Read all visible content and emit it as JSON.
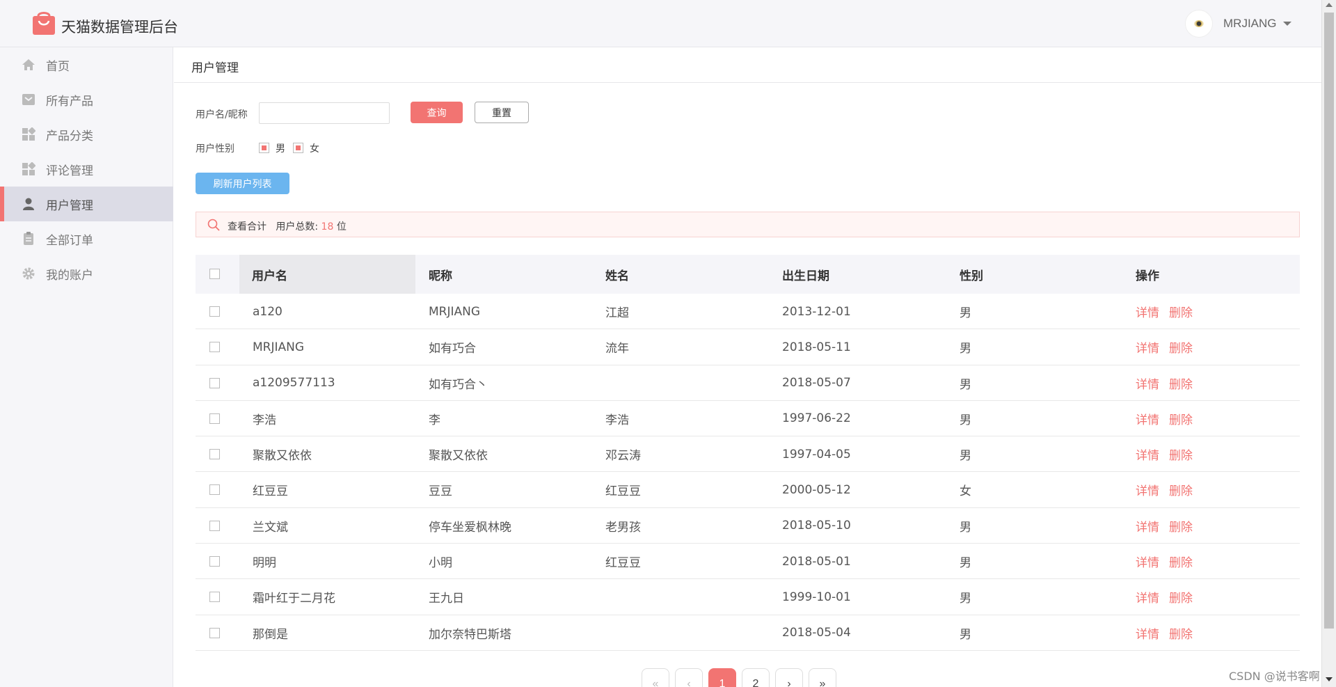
{
  "app": {
    "title": "天猫数据管理后台",
    "user": "MRJIANG"
  },
  "sidebar": {
    "items": [
      {
        "label": "首页",
        "icon": "home-icon"
      },
      {
        "label": "所有产品",
        "icon": "products-icon"
      },
      {
        "label": "产品分类",
        "icon": "category-icon"
      },
      {
        "label": "评论管理",
        "icon": "review-icon"
      },
      {
        "label": "用户管理",
        "icon": "user-icon",
        "active": true
      },
      {
        "label": "全部订单",
        "icon": "orders-icon"
      },
      {
        "label": "我的账户",
        "icon": "gear-icon"
      }
    ]
  },
  "page": {
    "title": "用户管理"
  },
  "filters": {
    "name_label": "用户名/昵称",
    "name_value": "",
    "query_label": "查询",
    "reset_label": "重置",
    "gender_label": "用户性别",
    "gender_options": [
      {
        "label": "男",
        "checked": true
      },
      {
        "label": "女",
        "checked": true
      }
    ],
    "refresh_label": "刷新用户列表"
  },
  "summary": {
    "view_label": "查看合计",
    "total_label": "用户总数:",
    "total": "18",
    "unit": "位"
  },
  "table": {
    "columns": [
      "用户名",
      "昵称",
      "姓名",
      "出生日期",
      "性别",
      "操作"
    ],
    "rows": [
      {
        "username": "a120",
        "nickname": "MRJIANG",
        "name": "江超",
        "birthday": "2013-12-01",
        "gender": "男"
      },
      {
        "username": "MRJIANG",
        "nickname": "如有巧合",
        "name": "流年",
        "birthday": "2018-05-11",
        "gender": "男"
      },
      {
        "username": "a1209577113",
        "nickname": "如有巧合丶",
        "name": "",
        "birthday": "2018-05-07",
        "gender": "男"
      },
      {
        "username": "李浩",
        "nickname": "李",
        "name": "李浩",
        "birthday": "1997-06-22",
        "gender": "男"
      },
      {
        "username": "聚散又依依",
        "nickname": "聚散又依依",
        "name": "邓云涛",
        "birthday": "1997-04-05",
        "gender": "男"
      },
      {
        "username": "红豆豆",
        "nickname": "豆豆",
        "name": "红豆豆",
        "birthday": "2000-05-12",
        "gender": "女"
      },
      {
        "username": "兰文斌",
        "nickname": "停车坐爱枫林晚",
        "name": "老男孩",
        "birthday": "2018-05-10",
        "gender": "男"
      },
      {
        "username": "明明",
        "nickname": "小明",
        "name": "红豆豆",
        "birthday": "2018-05-01",
        "gender": "男"
      },
      {
        "username": "霜叶红于二月花",
        "nickname": "王九日",
        "name": "",
        "birthday": "1999-10-01",
        "gender": "男"
      },
      {
        "username": "那倒是",
        "nickname": "加尔奈特巴斯塔",
        "name": "",
        "birthday": "2018-05-04",
        "gender": "男"
      }
    ],
    "actions": {
      "detail": "详情",
      "delete": "删除"
    }
  },
  "pagination": {
    "first": "«",
    "prev": "‹",
    "pages": [
      "1",
      "2"
    ],
    "current": "1",
    "next": "›",
    "last": "»"
  },
  "watermark": "CSDN @说书客啊",
  "colors": {
    "accent": "#f27472",
    "primary_blue": "#6bb5ef",
    "sidebar_bg": "#f6f6f9",
    "active_bg": "#dcdce6"
  }
}
